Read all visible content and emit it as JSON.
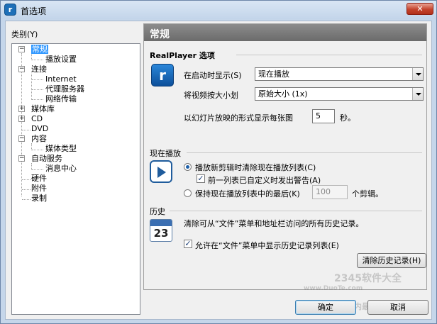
{
  "window": {
    "title": "首选项",
    "close_glyph": "✕"
  },
  "sidebar": {
    "label": "类别(Y)",
    "items": [
      {
        "label": "常规",
        "selected": true,
        "expander": "−"
      },
      {
        "label": "播放设置"
      },
      {
        "label": "连接",
        "expander": "−"
      },
      {
        "label": "Internet"
      },
      {
        "label": "代理服务器"
      },
      {
        "label": "网络传输"
      },
      {
        "label": "媒体库",
        "expander": "+"
      },
      {
        "label": "CD",
        "expander": "+"
      },
      {
        "label": "DVD"
      },
      {
        "label": "内容",
        "expander": "−"
      },
      {
        "label": "媒体类型"
      },
      {
        "label": "自动服务",
        "expander": "−"
      },
      {
        "label": "消息中心"
      },
      {
        "label": "硬件"
      },
      {
        "label": "附件"
      },
      {
        "label": "录制"
      }
    ]
  },
  "panel": {
    "header": "常规",
    "realplayer": {
      "title": "RealPlayer 选项",
      "startup_label": "在启动时显示(S)",
      "startup_value": "现在播放",
      "video_size_label": "将视频按大小划",
      "video_size_value": "原始大小 (1x)",
      "slideshow_label": "以幻灯片放映的形式显示每张图",
      "slideshow_value": "5",
      "slideshow_unit": "秒。"
    },
    "now_playing": {
      "title": "现在播放",
      "opt_replace": "播放新剪辑时清除现在播放列表(C)",
      "opt_warn": "前一列表已自定义时发出警告(A)",
      "opt_keep": "保持现在播放列表中的最后(K)",
      "keep_value": "100",
      "keep_unit": "个剪辑。"
    },
    "history": {
      "title": "历史",
      "calendar_day": "23",
      "clear_desc": "清除可从“文件”菜单和地址栏访问的所有历史记录。",
      "allow_label": "允许在“文件”菜单中显示历史记录列表(E)",
      "clear_button": "清除历史记录(H)"
    }
  },
  "footer": {
    "ok": "确定",
    "cancel": "取消"
  },
  "watermark": {
    "text1": "2345软件大全",
    "text2": "www.DuoTe.com",
    "text3": "国内最安全的软件站"
  },
  "colors": {
    "accent": "#3399ff",
    "title_bar": "#c3d5ea",
    "header_bar": "#7a7a7a"
  }
}
